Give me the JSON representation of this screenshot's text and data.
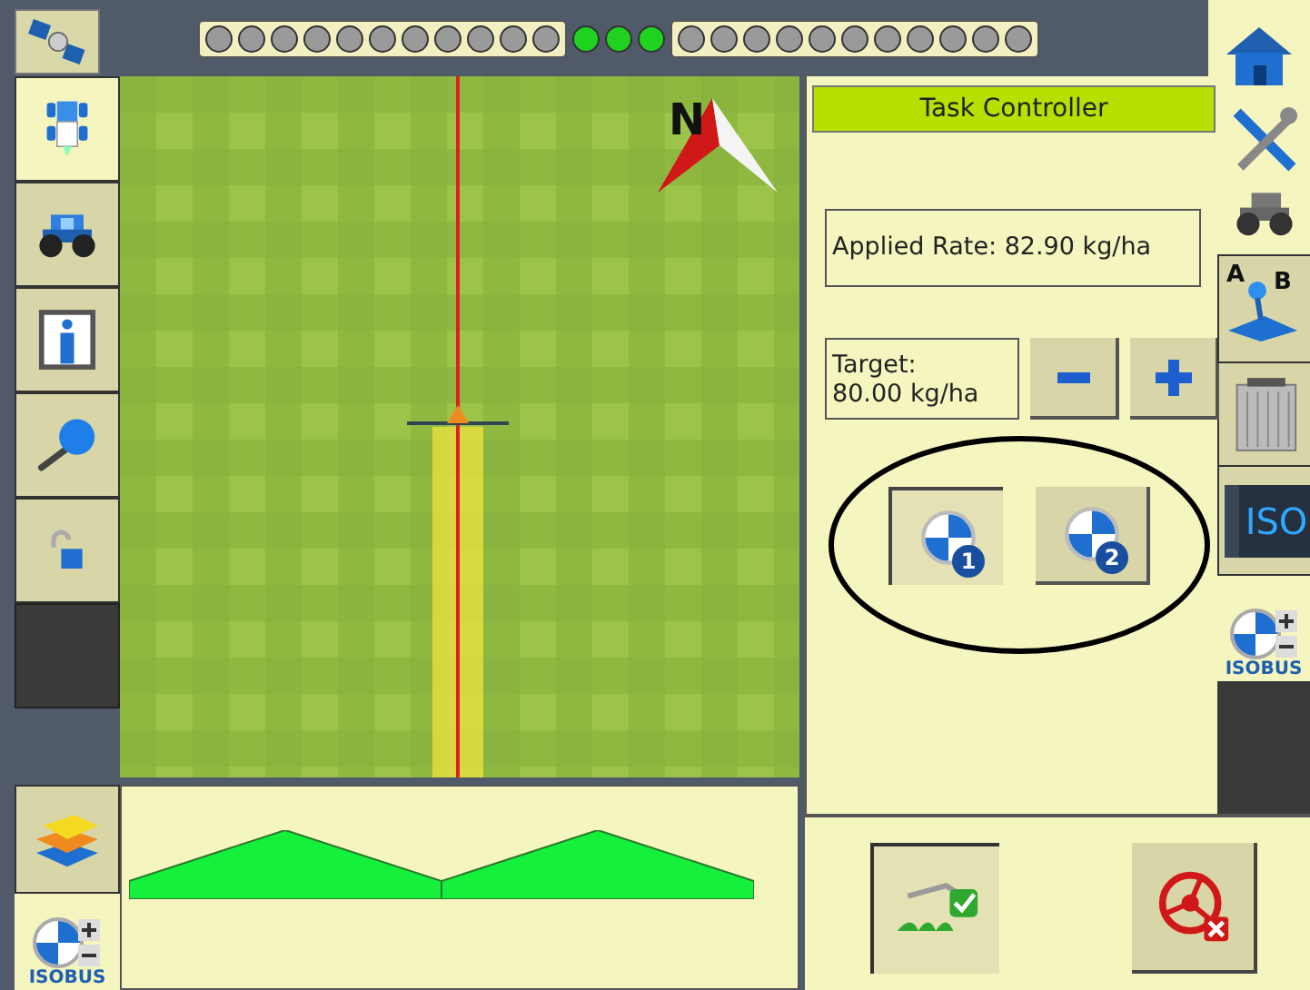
{
  "top_bar": {
    "leds": [
      {
        "lit": false
      },
      {
        "lit": false
      },
      {
        "lit": false
      },
      {
        "lit": false
      },
      {
        "lit": false
      },
      {
        "lit": false
      },
      {
        "lit": false
      },
      {
        "lit": false
      },
      {
        "lit": false
      },
      {
        "lit": false
      },
      {
        "lit": false
      },
      {
        "lit": true
      },
      {
        "lit": true
      },
      {
        "lit": true
      },
      {
        "lit": false
      },
      {
        "lit": false
      },
      {
        "lit": false
      },
      {
        "lit": false
      },
      {
        "lit": false
      },
      {
        "lit": false
      },
      {
        "lit": false
      },
      {
        "lit": false
      },
      {
        "lit": false
      },
      {
        "lit": false
      },
      {
        "lit": false
      }
    ]
  },
  "left_toolbar": [
    {
      "kind": "implement",
      "selected": true
    },
    {
      "kind": "tractor",
      "selected": false
    },
    {
      "kind": "info",
      "selected": false
    },
    {
      "kind": "zoom",
      "selected": false
    },
    {
      "kind": "lock",
      "selected": false
    }
  ],
  "map": {
    "compass_label": "N"
  },
  "task_controller": {
    "title": "Task Controller",
    "applied_rate": "Applied Rate: 82.90 kg/ha",
    "target_label": "Target:",
    "target_value": "80.00 kg/ha",
    "products": [
      {
        "number": "1",
        "selected": true
      },
      {
        "number": "2",
        "selected": false
      }
    ]
  },
  "right_toolbar": {
    "point_a": "A",
    "point_b": "B",
    "iso_label": "ISO",
    "isobus_label": "ISOBUS"
  },
  "boom_sections": [
    {
      "on": true
    },
    {
      "on": true
    }
  ],
  "bottom_left": {
    "isobus_label": "ISOBUS"
  }
}
